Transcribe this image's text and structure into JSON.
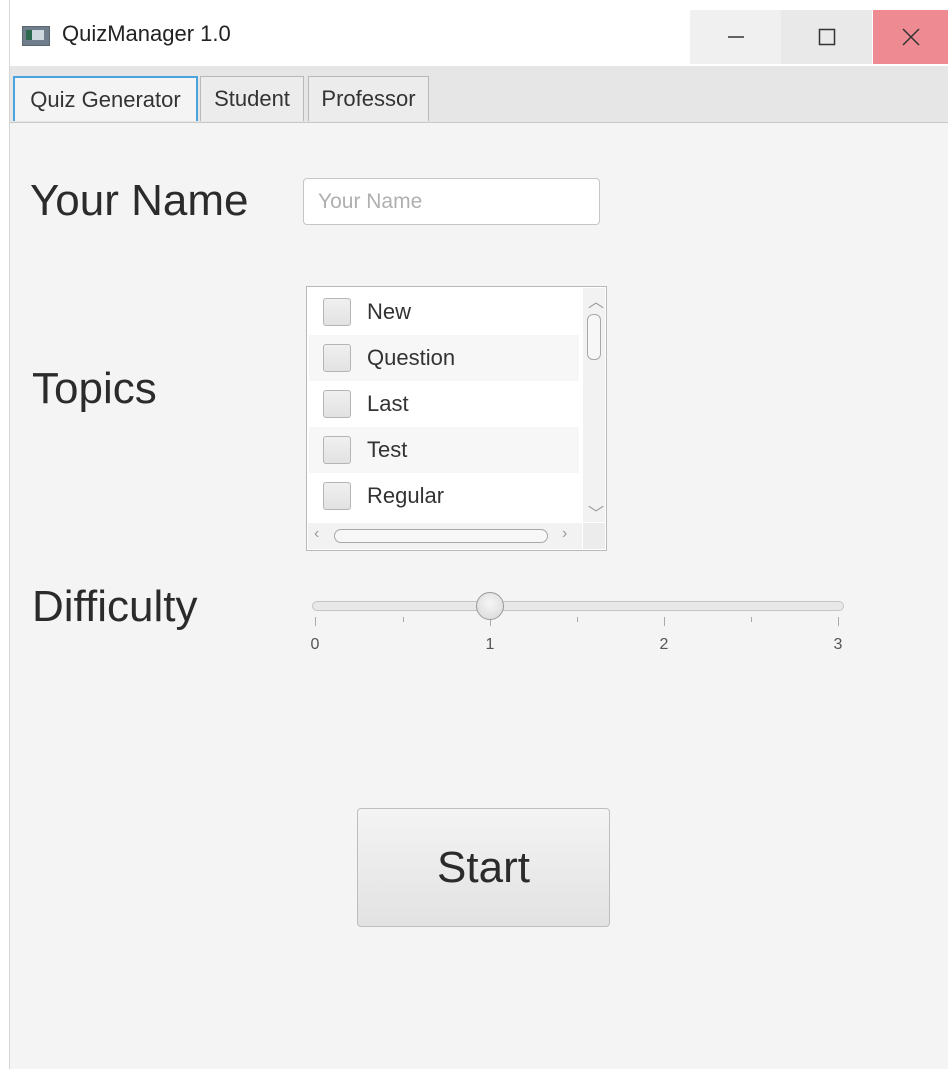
{
  "window": {
    "title": "QuizManager 1.0",
    "icons": [
      "app-icon",
      "minimize-icon",
      "maximize-icon",
      "close-icon"
    ],
    "close_color": "#ee8a92"
  },
  "tabs": [
    {
      "label": "Quiz Generator",
      "active": true
    },
    {
      "label": "Student",
      "active": false
    },
    {
      "label": "Professor",
      "active": false
    }
  ],
  "form": {
    "name_label": "Your Name",
    "name_placeholder": "Your Name",
    "name_value": "",
    "topics_label": "Topics",
    "topics": [
      "New",
      "Question",
      "Last",
      "Test",
      "Regular"
    ],
    "difficulty_label": "Difficulty",
    "difficulty": {
      "min": 0,
      "max": 3,
      "value": 1,
      "tick_labels": [
        "0",
        "1",
        "2",
        "3"
      ]
    },
    "start_label": "Start"
  },
  "accent_color": "#4aa3df"
}
